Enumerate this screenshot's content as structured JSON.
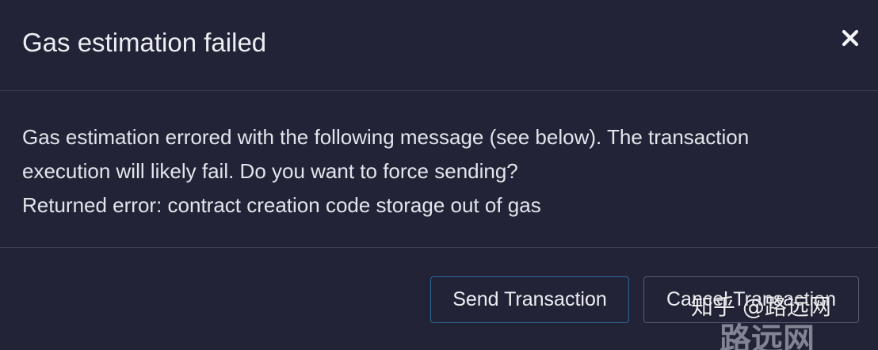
{
  "dialog": {
    "title": "Gas estimation failed",
    "close_icon": "close-icon",
    "message_lines": [
      "Gas estimation errored with the following message (see below). The transaction",
      "execution will likely fail. Do you want to force sending?",
      "Returned error: contract creation code storage out of gas"
    ],
    "buttons": {
      "send_label": "Send Transaction",
      "cancel_label": "Cancel Transaction"
    }
  },
  "watermark": {
    "line1": "知乎 @路远网",
    "line2": "路远网"
  },
  "colors": {
    "background": "#222336",
    "divider": "#3b3d55",
    "send_border": "#2d6a98",
    "cancel_border": "#5a5c74",
    "text": "#e8e9ef"
  }
}
